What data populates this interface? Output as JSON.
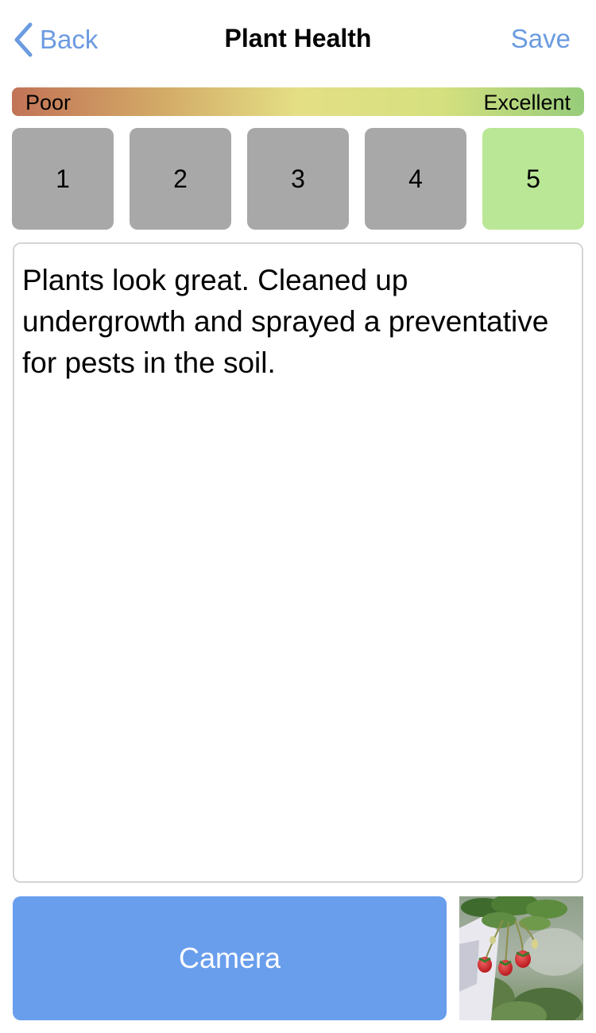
{
  "nav": {
    "back_label": "Back",
    "title": "Plant Health",
    "save_label": "Save",
    "accent_color": "#6b9be0"
  },
  "health_scale": {
    "low_label": "Poor",
    "high_label": "Excellent",
    "gradient_colors": [
      "#c27357",
      "#e4df85",
      "#96cc7a"
    ]
  },
  "rating": {
    "options": [
      "1",
      "2",
      "3",
      "4",
      "5"
    ],
    "selected": "5",
    "selected_color": "#b9e796",
    "unselected_color": "#a8a8a8"
  },
  "notes": {
    "text": "Plants look great. Cleaned up undergrowth and sprayed a preventative for pests in the soil."
  },
  "camera_button": {
    "label": "Camera",
    "color": "#699eed"
  },
  "photo_thumbnail": {
    "subject": "strawberry plant with red berries"
  }
}
